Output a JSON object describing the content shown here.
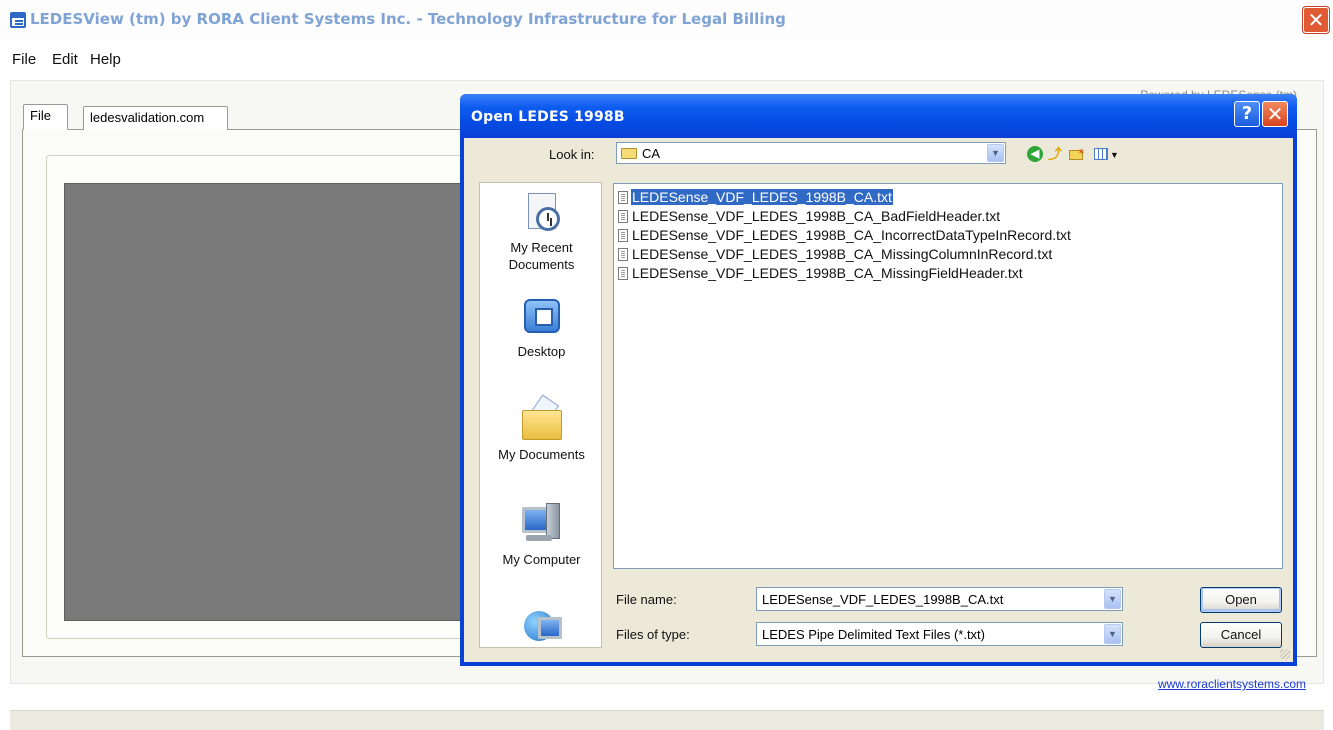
{
  "app": {
    "title": "LEDESView (tm) by RORA Client Systems Inc. - Technology Infrastructure for Legal Billing",
    "close_glyph": "✕",
    "faint_header_text": "Powered by LEDESense (tm)"
  },
  "menu": [
    "File",
    "Edit",
    "Help"
  ],
  "tabs": [
    "File",
    "ledesvalidation.com"
  ],
  "website_link": "www.roraclientsystems.com",
  "dialog": {
    "title": "Open LEDES 1998B",
    "help_glyph": "?",
    "close_glyph": "✕",
    "look_in_label": "Look in:",
    "look_in_value": "CA",
    "places": [
      {
        "label": "My Recent Documents",
        "icon": "recent-documents-icon"
      },
      {
        "label": "Desktop",
        "icon": "desktop-icon"
      },
      {
        "label": "My Documents",
        "icon": "my-documents-icon"
      },
      {
        "label": "My Computer",
        "icon": "my-computer-icon"
      },
      {
        "label": "",
        "icon": "network-places-icon"
      }
    ],
    "files": [
      {
        "name": "LEDESense_VDF_LEDES_1998B_CA.txt",
        "selected": true
      },
      {
        "name": "LEDESense_VDF_LEDES_1998B_CA_BadFieldHeader.txt",
        "selected": false
      },
      {
        "name": "LEDESense_VDF_LEDES_1998B_CA_IncorrectDataTypeInRecord.txt",
        "selected": false
      },
      {
        "name": "LEDESense_VDF_LEDES_1998B_CA_MissingColumnInRecord.txt",
        "selected": false
      },
      {
        "name": "LEDESense_VDF_LEDES_1998B_CA_MissingFieldHeader.txt",
        "selected": false
      }
    ],
    "file_name_label": "File name:",
    "file_name_value": "LEDESense_VDF_LEDES_1998B_CA.txt",
    "file_type_label": "Files of type:",
    "file_type_value": "LEDES Pipe Delimited Text Files (*.txt)",
    "open_label": "Open",
    "cancel_label": "Cancel"
  },
  "colors": {
    "selection": "#316ac5",
    "dialog_frame": "#0a3fd8",
    "dialog_face": "#ece9d8",
    "link": "#1a3cd6"
  }
}
